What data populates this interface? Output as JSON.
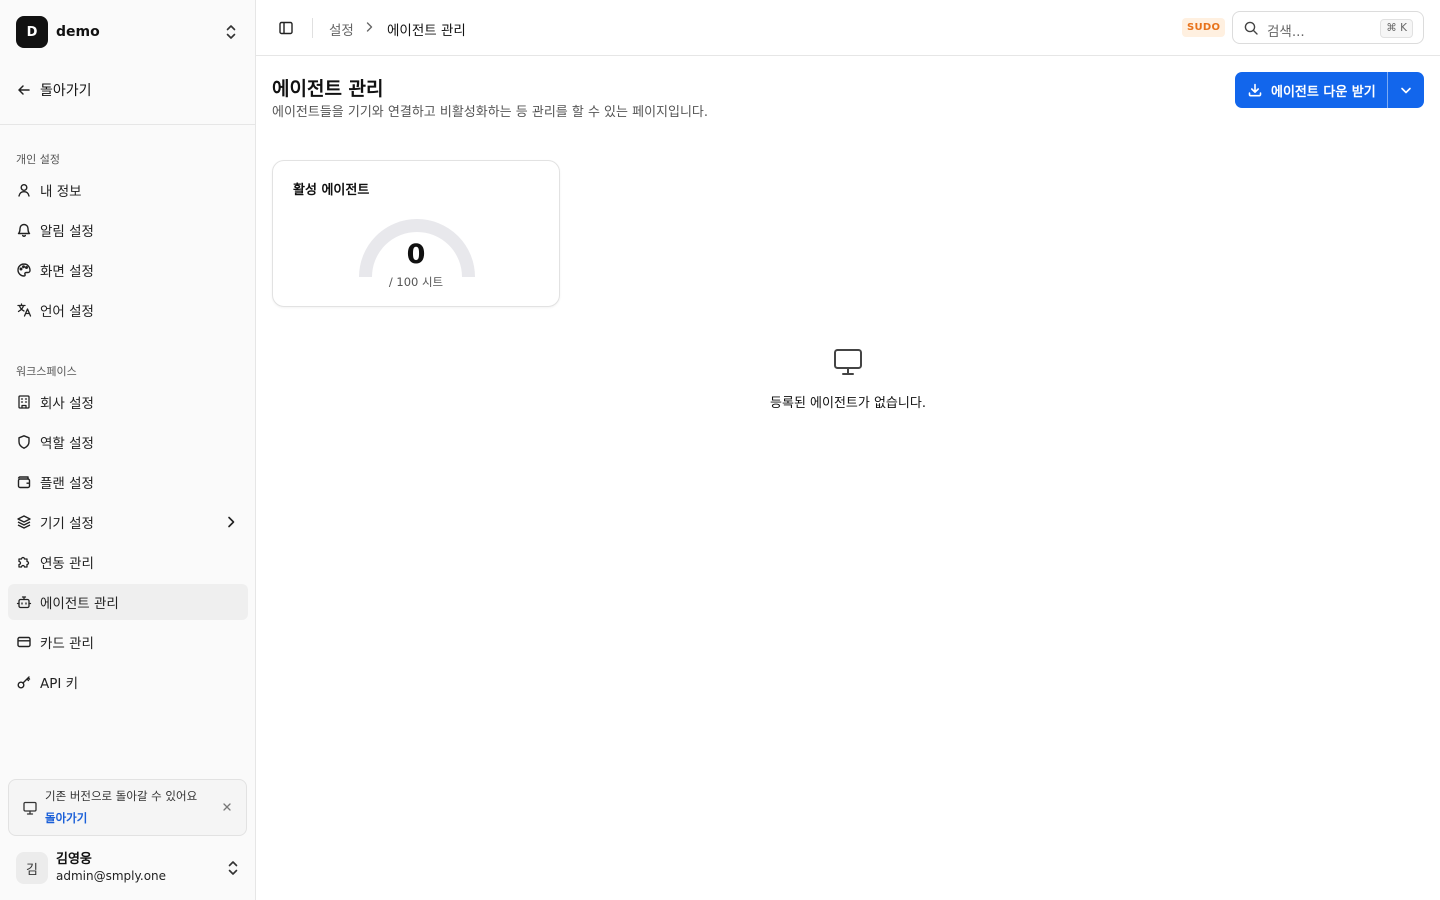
{
  "workspace": {
    "initial": "D",
    "name": "demo"
  },
  "sidebar": {
    "back_label": "돌아가기",
    "personal_label": "개인 설정",
    "personal_items": [
      {
        "label": "내 정보",
        "icon": "user-icon"
      },
      {
        "label": "알림 설정",
        "icon": "bell-icon"
      },
      {
        "label": "화면 설정",
        "icon": "palette-icon"
      },
      {
        "label": "언어 설정",
        "icon": "language-icon"
      }
    ],
    "workspace_label": "워크스페이스",
    "workspace_items": [
      {
        "label": "회사 설정",
        "icon": "building-icon"
      },
      {
        "label": "역할 설정",
        "icon": "shield-icon"
      },
      {
        "label": "플랜 설정",
        "icon": "wallet-icon"
      },
      {
        "label": "기기 설정",
        "icon": "layers-icon"
      },
      {
        "label": "연동 관리",
        "icon": "puzzle-icon"
      },
      {
        "label": "에이전트 관리",
        "icon": "bot-icon"
      },
      {
        "label": "카드 관리",
        "icon": "credit-card-icon"
      },
      {
        "label": "API 키",
        "icon": "key-icon"
      }
    ],
    "active_item": "에이전트 관리",
    "banner": {
      "text": "기존 버전으로 돌아갈 수 있어요",
      "link": "돌아가기"
    },
    "user": {
      "initial": "김",
      "name": "김영웅",
      "email": "admin@smply.one"
    }
  },
  "topbar": {
    "breadcrumb": [
      "설정",
      "에이전트 관리"
    ],
    "badge": "SUDO",
    "search_placeholder": "검색...",
    "search_shortcut": "⌘ K"
  },
  "main": {
    "title": "에이전트 관리",
    "description": "에이전트들을 기기와 연결하고 비활성화하는 등 관리를 할 수 있는 페이지입니다.",
    "download_button": "에이전트 다운 받기",
    "card": {
      "title": "활성 에이전트",
      "value": "0",
      "capacity": "/ 100 시트",
      "active_count": 0,
      "total_seats": 100
    },
    "empty_state": "등록된 에이전트가 없습니다."
  },
  "colors": {
    "primary": "#1266ec",
    "sudo_text": "#e8721a",
    "sudo_bg": "#fff0e0",
    "link": "#1a5fd8",
    "gauge_track": "#e8e8ec"
  }
}
